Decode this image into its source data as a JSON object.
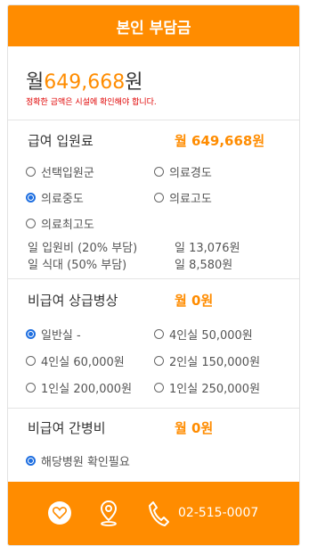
{
  "header": {
    "title": "본인 부담금"
  },
  "total": {
    "prefix": "월",
    "amount": "649,668",
    "suffix": "원",
    "note": "정확한 금액은 시설에 확인해야 합니다."
  },
  "sections": {
    "inpatient": {
      "title": "급여 입원료",
      "amount": "월 649,668원",
      "options": [
        {
          "label": "선택입원군",
          "selected": false
        },
        {
          "label": "의료경도",
          "selected": false
        },
        {
          "label": "의료중도",
          "selected": true
        },
        {
          "label": "의료고도",
          "selected": false
        },
        {
          "label": "의료최고도",
          "selected": false
        }
      ],
      "details": [
        {
          "label": "일 입원비 (20% 부담)",
          "value": "일 13,076원"
        },
        {
          "label": "일 식대 (50% 부담)",
          "value": "일 8,580원"
        }
      ]
    },
    "room": {
      "title": "비급여 상급병상",
      "amount": "월 0원",
      "options": [
        {
          "label": "일반실 -",
          "selected": true
        },
        {
          "label": "4인실 50,000원",
          "selected": false
        },
        {
          "label": "4인실 60,000원",
          "selected": false
        },
        {
          "label": "2인실 150,000원",
          "selected": false
        },
        {
          "label": "1인실 200,000원",
          "selected": false
        },
        {
          "label": "1인실 250,000원",
          "selected": false
        }
      ]
    },
    "caregiver": {
      "title": "비급여 간병비",
      "amount": "월 0원",
      "options": [
        {
          "label": "해당병원 확인필요",
          "selected": true
        }
      ]
    }
  },
  "footer": {
    "icons": [
      "heart-icon",
      "location-pin-icon",
      "phone-icon"
    ],
    "phone": "02-515-0007"
  },
  "colors": {
    "accent": "#ff8c00",
    "note": "#e00000",
    "radio_selected": "#1f6fe0"
  }
}
